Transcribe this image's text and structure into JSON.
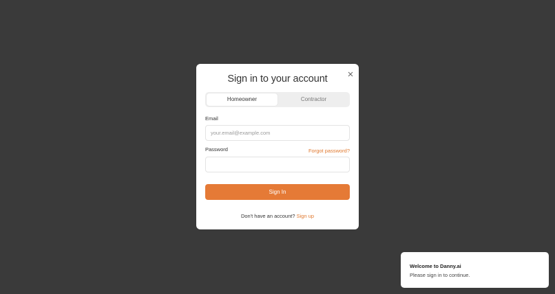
{
  "modal": {
    "title": "Sign in to your account",
    "close_icon": "close-icon",
    "tabs": [
      {
        "label": "Homeowner",
        "active": true
      },
      {
        "label": "Contractor",
        "active": false
      }
    ],
    "email": {
      "label": "Email",
      "placeholder": "your.email@example.com",
      "value": ""
    },
    "password": {
      "label": "Password",
      "value": "",
      "forgot_label": "Forgot password?"
    },
    "signin_label": "Sign In",
    "footer": {
      "prompt": "Don't have an account?",
      "signup_label": "Sign up"
    }
  },
  "toast": {
    "title": "Welcome to Danny.ai",
    "message": "Please sign in to continue."
  },
  "colors": {
    "backdrop": "#3a3a3a",
    "accent": "#e57a36",
    "link": "#e0792f"
  }
}
